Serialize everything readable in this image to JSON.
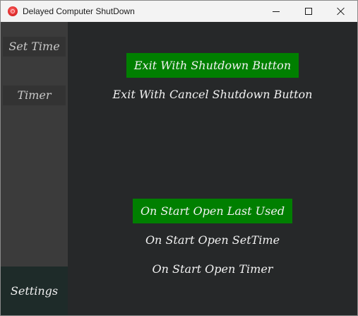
{
  "window": {
    "title": "Delayed Computer ShutDown",
    "icon": "app-power-icon",
    "controls": [
      "minimize-icon",
      "maximize-icon",
      "close-icon"
    ]
  },
  "sidebar": {
    "items": [
      {
        "label": "Set Time",
        "active": false
      },
      {
        "label": "Timer",
        "active": false
      },
      {
        "label": "Settings",
        "active": true
      }
    ]
  },
  "settings": {
    "exit_options": [
      {
        "label": "Exit With Shutdown Button",
        "selected": true
      },
      {
        "label": "Exit With Cancel Shutdown Button",
        "selected": false
      }
    ],
    "start_options": [
      {
        "label": "On Start Open Last Used",
        "selected": true
      },
      {
        "label": "On Start Open SetTime",
        "selected": false
      },
      {
        "label": "On Start Open Timer",
        "selected": false
      }
    ]
  },
  "colors": {
    "selected_bg": "#007f00",
    "content_bg": "#262829",
    "sidebar_bg": "#3b3b3b",
    "sidebar_active_bg": "#1e2b29"
  }
}
